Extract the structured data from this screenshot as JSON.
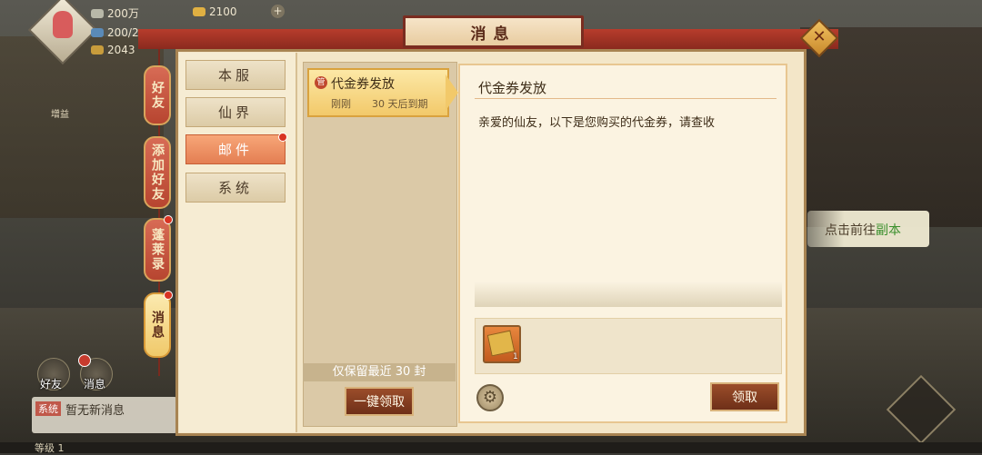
{
  "hud": {
    "silver": "200万",
    "gold": "2100",
    "stamina": "200/2",
    "coins": "2043",
    "buff_label": "增益"
  },
  "dialog": {
    "title": "消息",
    "close_icon": "close-icon"
  },
  "side_tabs": [
    {
      "label": "好友",
      "active": false,
      "badge": false
    },
    {
      "label": "添加好友",
      "active": false,
      "badge": false
    },
    {
      "label": "蓬莱录",
      "active": false,
      "badge": true
    },
    {
      "label": "消息",
      "active": true,
      "badge": true
    }
  ],
  "categories": [
    {
      "label": "本服",
      "active": false,
      "badge": false
    },
    {
      "label": "仙界",
      "active": false,
      "badge": false
    },
    {
      "label": "邮件",
      "active": true,
      "badge": true
    },
    {
      "label": "系统",
      "active": false,
      "badge": false
    }
  ],
  "mail_list": {
    "items": [
      {
        "icon": "管",
        "title": "代金券发放",
        "time": "刚刚",
        "expire": "30 天后到期"
      }
    ],
    "keep_note": "仅保留最近 30 封",
    "claim_all_label": "一键领取"
  },
  "detail": {
    "title": "代金券发放",
    "body": "亲爱的仙友，以下是您购买的代金券，请查收",
    "attachment_count": "1",
    "claim_label": "领取"
  },
  "chat": {
    "friends_label": "好友",
    "messages_label": "消息",
    "tag": "系统",
    "text": "暂无新消息"
  },
  "quest": {
    "prefix": "点击前往",
    "highlight": "副本"
  },
  "level": "等级 1",
  "colors": {
    "accent_red": "#b73c2c",
    "gold": "#f2c96a",
    "active_category": "#e47e52",
    "button_brown": "#6e2f18"
  }
}
